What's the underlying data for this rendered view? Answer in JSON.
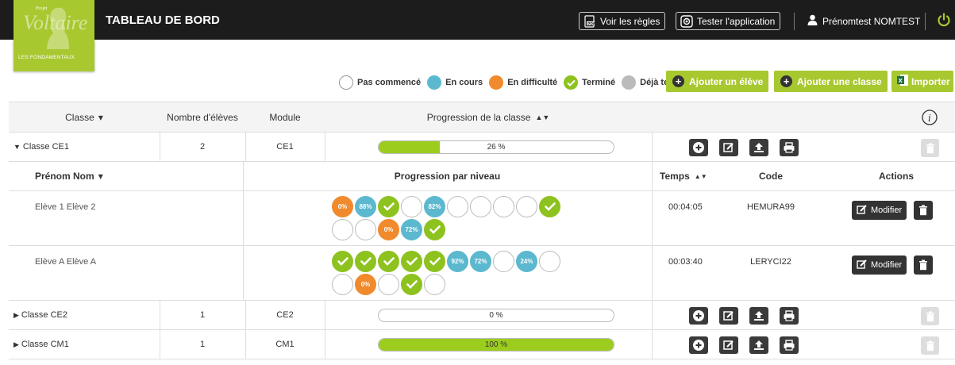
{
  "header": {
    "logo_text_top": "Projet",
    "logo_text_main": "Voltaire",
    "logo_text_bottom": "LES FONDAMENTAUX",
    "title": "TABLEAU DE BORD",
    "rules_button": "Voir les règles",
    "test_button": "Tester l'application",
    "user_name": "Prénomtest NOMTEST"
  },
  "legend": [
    {
      "label": "Pas commencé",
      "color": "#ffffff"
    },
    {
      "label": "En cours",
      "color": "#5bb8cf"
    },
    {
      "label": "En difficulté",
      "color": "#f08a2c"
    },
    {
      "label": "Terminé",
      "color": "#8dc21f"
    },
    {
      "label": "Déjà terminé",
      "color": "#bbbbbb"
    }
  ],
  "actions": {
    "add_student": "Ajouter un élève",
    "add_class": "Ajouter une classe",
    "import": "Importer"
  },
  "table": {
    "col_class": "Classe",
    "col_count": "Nombre d'élèves",
    "col_module": "Module",
    "col_progress": "Progression de la classe"
  },
  "classes": [
    {
      "name": "Classe CE1",
      "count": "2",
      "module": "CE1",
      "progress": 26,
      "progress_label": "26 %"
    },
    {
      "name": "Classe CE2",
      "count": "1",
      "module": "CE2",
      "progress": 0,
      "progress_label": "0 %"
    },
    {
      "name": "Classe CM1",
      "count": "1",
      "module": "CM1",
      "progress": 100,
      "progress_label": "100 %"
    }
  ],
  "students_header": {
    "name": "Prénom Nom",
    "levels": "Progression par niveau",
    "time": "Temps",
    "code": "Code",
    "actions": "Actions"
  },
  "students": [
    {
      "name": "Elève 1 Elève 2",
      "time": "00:04:05",
      "code": "HEMURA99",
      "modify": "Modifier",
      "levels": [
        {
          "s": "difficulty",
          "t": "0%"
        },
        {
          "s": "progress",
          "t": "88%"
        },
        {
          "s": "done",
          "t": ""
        },
        {
          "s": "none",
          "t": ""
        },
        {
          "s": "progress",
          "t": "82%"
        },
        {
          "s": "none",
          "t": ""
        },
        {
          "s": "none",
          "t": ""
        },
        {
          "s": "none",
          "t": ""
        },
        {
          "s": "none",
          "t": ""
        },
        {
          "s": "done",
          "t": ""
        },
        {
          "s": "none",
          "t": ""
        },
        {
          "s": "none",
          "t": ""
        },
        {
          "s": "difficulty",
          "t": "0%"
        },
        {
          "s": "progress",
          "t": "72%"
        },
        {
          "s": "done",
          "t": ""
        }
      ]
    },
    {
      "name": "Elève A Elève A",
      "time": "00:03:40",
      "code": "LERYCI22",
      "modify": "Modifier",
      "levels": [
        {
          "s": "done",
          "t": ""
        },
        {
          "s": "done",
          "t": ""
        },
        {
          "s": "done",
          "t": ""
        },
        {
          "s": "done",
          "t": ""
        },
        {
          "s": "done",
          "t": ""
        },
        {
          "s": "progress",
          "t": "92%"
        },
        {
          "s": "progress",
          "t": "72%"
        },
        {
          "s": "none",
          "t": ""
        },
        {
          "s": "progress",
          "t": "24%"
        },
        {
          "s": "none",
          "t": ""
        },
        {
          "s": "none",
          "t": ""
        },
        {
          "s": "difficulty",
          "t": "0%"
        },
        {
          "s": "none",
          "t": ""
        },
        {
          "s": "done",
          "t": ""
        },
        {
          "s": "none",
          "t": ""
        }
      ]
    }
  ]
}
